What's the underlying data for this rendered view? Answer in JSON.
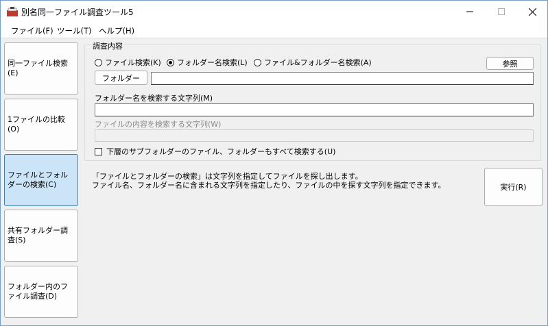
{
  "window": {
    "title": "別名同一ファイル調査ツール5",
    "controls": {
      "minimize": "—",
      "maximize": "☐",
      "close": "✕"
    }
  },
  "menu": [
    {
      "label": "ファイル(F)"
    },
    {
      "label": "ツール(T)"
    },
    {
      "label": "ヘルプ(H)"
    }
  ],
  "nav": [
    {
      "label": "同一ファイル検索(E)",
      "active": false
    },
    {
      "label": "1ファイルの比較(O)",
      "active": false
    },
    {
      "label": "ファイルとフォルダーの検索(C)",
      "active": true
    },
    {
      "label": "共有フォルダー調査(S)",
      "active": false
    },
    {
      "label": "フォルダー内のファイル調査(D)",
      "active": false
    }
  ],
  "group": {
    "title": "調査内容",
    "radios": [
      {
        "label": "ファイル検索(K)",
        "checked": false
      },
      {
        "label": "フォルダー名検索(L)",
        "checked": true
      },
      {
        "label": "ファイル&フォルダー名検索(A)",
        "checked": false
      }
    ],
    "browse_label": "参照",
    "folder_button_label": "フォルダー",
    "folder_value": "",
    "name_search_label": "フォルダー名を検索する文字列(M)",
    "name_search_value": "",
    "content_search_label": "ファイルの内容を検索する文字列(W)",
    "content_search_value": "",
    "subfolder_checkbox_label": "下層のサブフォルダーのファイル、フォルダーもすべて検索する(U)",
    "subfolder_checked": false
  },
  "description": {
    "line1": "「ファイルとフォルダーの検索」は文字列を指定してファイルを探し出します。",
    "line2": "ファイル名、フォルダー名に含まれる文字列を指定したり、ファイルの中を探す文字列を指定できます。"
  },
  "run_label": "実行(R)"
}
